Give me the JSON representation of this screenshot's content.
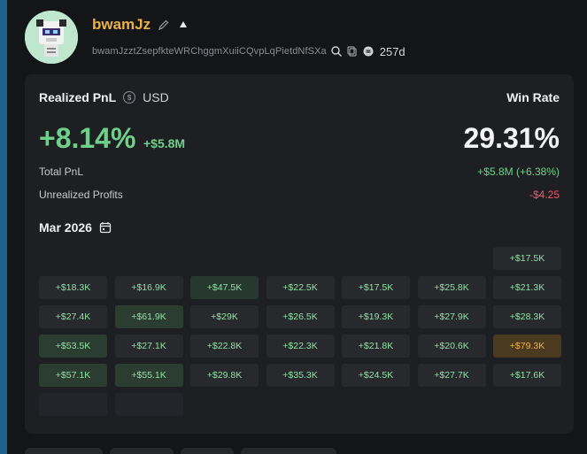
{
  "profile": {
    "name": "bwamJz",
    "address": "bwamJzztZsepfkteWRChggmXuiiCQvpLqPietdNfSXa",
    "age": "257d",
    "icons": [
      "edit-icon",
      "user-icon",
      "search-icon",
      "copy-icon",
      "coin-icon"
    ]
  },
  "colors": {
    "positive": "#6fd08a",
    "negative": "#f2556a",
    "accent_name": "#e7b24a",
    "highlight": "#f0b24a"
  },
  "pnl": {
    "title": "Realized PnL",
    "currency": "USD",
    "percent": "+8.14%",
    "amount": "+$5.8M",
    "win_rate_label": "Win Rate",
    "win_rate": "29.31%",
    "total_label": "Total PnL",
    "total_value": "+$5.8M (+6.38%)",
    "unrealized_label": "Unrealized Profits",
    "unrealized_value": "-$4.25"
  },
  "calendar": {
    "month": "Mar 2026",
    "rows": [
      [
        "",
        "",
        "",
        "",
        "",
        "",
        "+$17.5K"
      ],
      [
        "+$18.3K",
        "+$16.9K",
        "+$47.5K",
        "+$22.5K",
        "+$17.5K",
        "+$25.8K",
        "+$21.3K"
      ],
      [
        "+$27.4K",
        "+$61.9K",
        "+$29K",
        "+$26.5K",
        "+$19.3K",
        "+$27.9K",
        "+$28.3K"
      ],
      [
        "+$53.5K",
        "+$27.1K",
        "+$22.8K",
        "+$22.3K",
        "+$21.8K",
        "+$20.6K",
        "+$79.3K"
      ],
      [
        "+$57.1K",
        "+$55.1K",
        "+$29.8K",
        "+$35.3K",
        "+$24.5K",
        "+$27.7K",
        "+$17.6K"
      ],
      [
        "",
        ""
      ]
    ]
  }
}
